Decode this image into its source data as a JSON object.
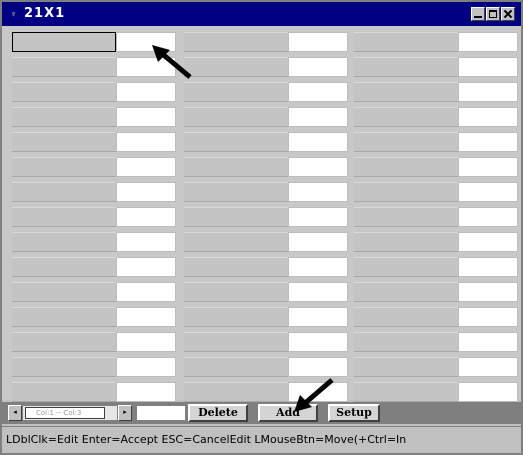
{
  "window": {
    "title": "21X1",
    "system_icon": "window-menu-icon"
  },
  "grid": {
    "columns": 3,
    "rows": 15,
    "selected_cell": {
      "column": 1,
      "row": 1
    }
  },
  "toolbar": {
    "scroll_left_glyph": "◂",
    "scroll_right_glyph": "▸",
    "scroll_thumb_label": "Col:1 -- Col:3",
    "delete_label": "Delete",
    "add_label": "Add",
    "setup_label": "Setup"
  },
  "status": {
    "text": "LDblClk=Edit  Enter=Accept  ESC=CancelEdit  LMouseBtn=Move(+Ctrl=In"
  },
  "colors": {
    "titlebar": "#000080",
    "window_bg": "#c0c0c0",
    "cell_gray": "#c4c4c4",
    "cell_white": "#ffffff",
    "arrow": "#000000"
  }
}
